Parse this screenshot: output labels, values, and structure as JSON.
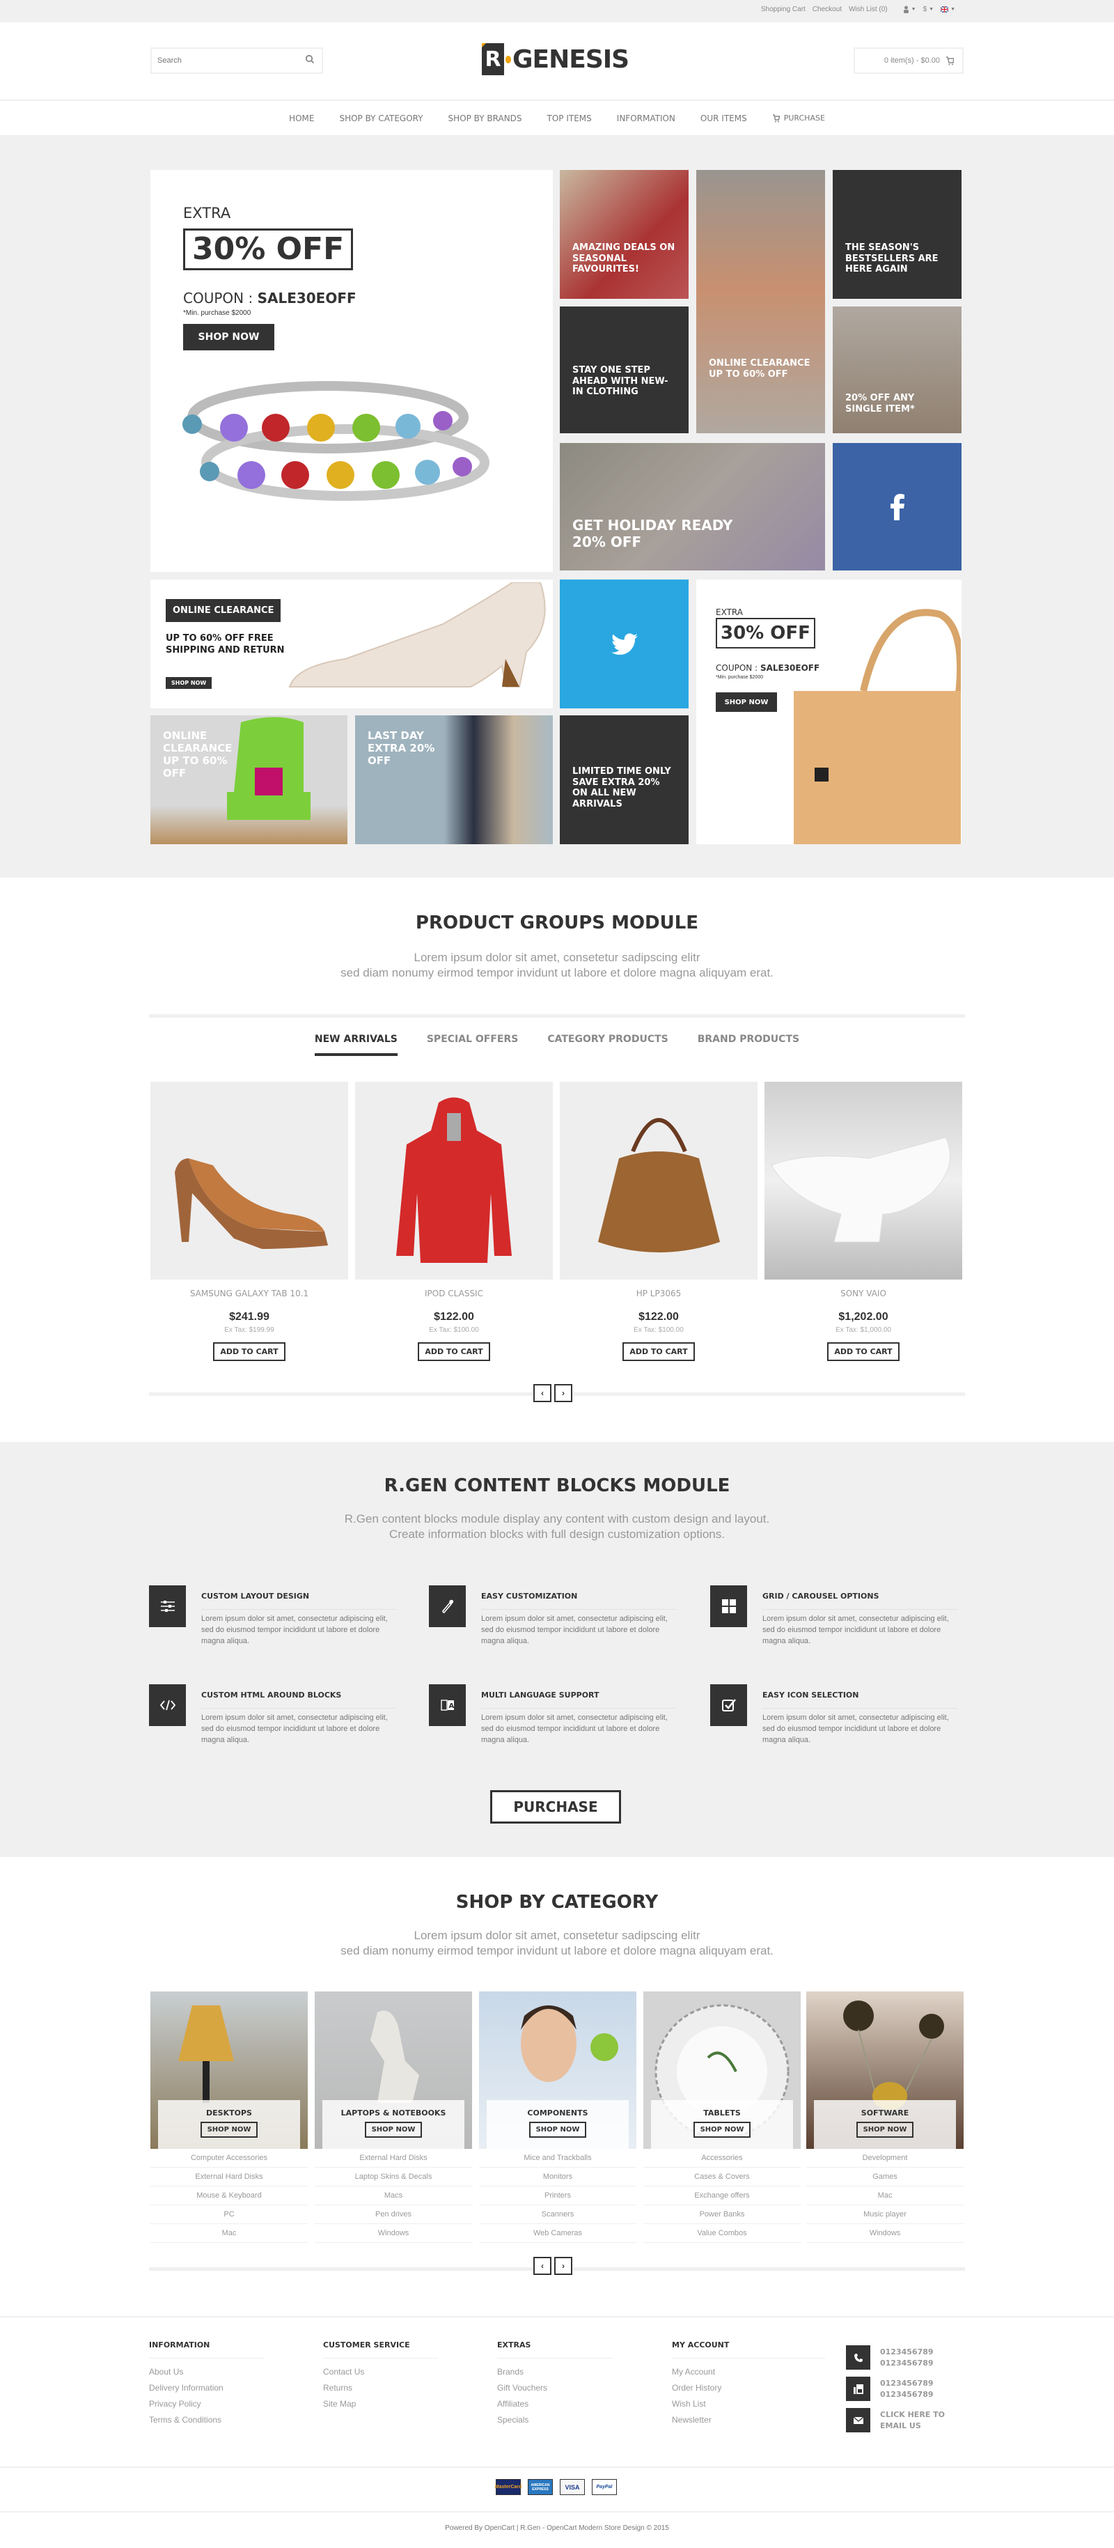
{
  "topbar": {
    "links": [
      "Shopping Cart",
      "Checkout",
      "Wish List (0)"
    ],
    "account_icon": "user-icon",
    "currency": "$",
    "language_icon": "flag-uk-icon"
  },
  "header": {
    "search_placeholder": "Search",
    "logo_letter": "R",
    "logo_text": "GENESIS",
    "cart_text": "0 item(s) - $0.00"
  },
  "nav": {
    "items": [
      "HOME",
      "SHOP BY CATEGORY",
      "SHOP BY BRANDS",
      "TOP ITEMS",
      "INFORMATION",
      "OUR ITEMS",
      "PURCHASE"
    ]
  },
  "banners": {
    "main": {
      "extra": "EXTRA",
      "offer": "30% OFF",
      "coupon_label": "COUPON : ",
      "coupon_code": "SALE30EOFF",
      "min": "*Min. purchase $2000",
      "button": "SHOP NOW"
    },
    "amazing": "AMAZING DEALS ON SEASONAL FAVOURITES!",
    "couple": "ONLINE CLEARANCE UP TO 60% OFF",
    "bestsellers": "THE SEASON'S BESTSELLERS ARE HERE AGAIN",
    "stay": "STAY ONE STEP AHEAD WITH NEW-IN CLOTHING",
    "sunglasses": "20% OFF ANY SINGLE ITEM*",
    "holiday": "GET HOLIDAY READY 20% OFF",
    "facebook_icon": "facebook-icon",
    "shoe": {
      "badge": "ONLINE CLEARANCE",
      "text": "UP TO 60% OFF FREE SHIPPING AND RETURN",
      "button": "SHOP NOW"
    },
    "twitter_icon": "twitter-icon",
    "bag": {
      "extra": "EXTRA",
      "offer": "30% OFF",
      "coupon_label": "COUPON : ",
      "coupon_code": "SALE30EOFF",
      "min": "*Min. purchase $2000",
      "button": "SHOP NOW"
    },
    "chair": "ONLINE CLEARANCE UP TO 60% OFF",
    "lastday": "LAST DAY EXTRA 20% OFF",
    "limited": "LIMITED TIME ONLY SAVE EXTRA 20% ON ALL NEW ARRIVALS"
  },
  "product_groups": {
    "title": "PRODUCT GROUPS MODULE",
    "subtitle_1": "Lorem ipsum dolor sit amet, consetetur sadipscing elitr",
    "subtitle_2": "sed diam nonumy eirmod tempor invidunt ut labore et dolore magna aliquyam erat.",
    "tabs": [
      "NEW ARRIVALS",
      "SPECIAL OFFERS",
      "CATEGORY PRODUCTS",
      "BRAND PRODUCTS"
    ],
    "active_tab": "NEW ARRIVALS",
    "products": [
      {
        "name": "SAMSUNG GALAXY TAB 10.1",
        "price": "$241.99",
        "ex_tax": "Ex Tax: $199.99",
        "button": "ADD TO CART",
        "image": "brown-heel-shoe"
      },
      {
        "name": "IPOD CLASSIC",
        "price": "$122.00",
        "ex_tax": "Ex Tax: $100.00",
        "button": "ADD TO CART",
        "image": "red-jacket"
      },
      {
        "name": "HP LP3065",
        "price": "$122.00",
        "ex_tax": "Ex Tax: $100.00",
        "button": "ADD TO CART",
        "image": "brown-handbag"
      },
      {
        "name": "SONY VAIO",
        "price": "$1,202.00",
        "ex_tax": "Ex Tax: $1,000.00",
        "button": "ADD TO CART",
        "image": "white-gravy-boat"
      }
    ],
    "prev": "‹",
    "next": "›"
  },
  "content_blocks": {
    "title": "R.GEN CONTENT BLOCKS MODULE",
    "subtitle_1": "R.Gen content blocks module display any content with custom design and layout.",
    "subtitle_2": "Create information blocks with full design customization options.",
    "features": [
      {
        "title": "CUSTOM LAYOUT DESIGN",
        "text": "Lorem ipsum dolor sit amet, consectetur adipiscing elit, sed do eiusmod tempor incididunt ut labore et dolore magna aliqua.",
        "icon": "sliders-icon"
      },
      {
        "title": "EASY CUSTOMIZATION",
        "text": "Lorem ipsum dolor sit amet, consectetur adipiscing elit, sed do eiusmod tempor incididunt ut labore et dolore magna aliqua.",
        "icon": "eyedropper-icon"
      },
      {
        "title": "GRID / CAROUSEL OPTIONS",
        "text": "Lorem ipsum dolor sit amet, consectetur adipiscing elit, sed do eiusmod tempor incididunt ut labore et dolore magna aliqua.",
        "icon": "grid-icon"
      },
      {
        "title": "CUSTOM HTML AROUND BLOCKS",
        "text": "Lorem ipsum dolor sit amet, consectetur adipiscing elit, sed do eiusmod tempor incididunt ut labore et dolore magna aliqua.",
        "icon": "code-icon"
      },
      {
        "title": "MULTI LANGUAGE SUPPORT",
        "text": "Lorem ipsum dolor sit amet, consectetur adipiscing elit, sed do eiusmod tempor incididunt ut labore et dolore magna aliqua.",
        "icon": "translate-icon"
      },
      {
        "title": "EASY ICON SELECTION",
        "text": "Lorem ipsum dolor sit amet, consectetur adipiscing elit, sed do eiusmod tempor incididunt ut labore et dolore magna aliqua.",
        "icon": "checkbox-icon"
      }
    ],
    "purchase_button": "PURCHASE"
  },
  "shop_by_category": {
    "title": "SHOP BY CATEGORY",
    "subtitle_1": "Lorem ipsum dolor sit amet, consetetur sadipscing elitr",
    "subtitle_2": "sed diam nonumy eirmod tempor invidunt ut labore et dolore magna aliquyam erat.",
    "categories": [
      {
        "name": "DESKTOPS",
        "button": "SHOP NOW",
        "links": [
          "Computer Accessories",
          "External Hard Disks",
          "Mouse & Keyboard",
          "PC",
          "Mac"
        ]
      },
      {
        "name": "LAPTOPS & NOTEBOOKS",
        "button": "SHOP NOW",
        "links": [
          "External Hard Disks",
          "Laptop Skins & Decals",
          "Macs",
          "Pen drives",
          "Windows"
        ]
      },
      {
        "name": "COMPONENTS",
        "button": "SHOP NOW",
        "links": [
          "Mice and Trackballs",
          "Monitors",
          "Printers",
          "Scanners",
          "Web Cameras"
        ]
      },
      {
        "name": "TABLETS",
        "button": "SHOP NOW",
        "links": [
          "Accessories",
          "Cases & Covers",
          "Exchange offers",
          "Power Banks",
          "Value Combos"
        ]
      },
      {
        "name": "SOFTWARE",
        "button": "SHOP NOW",
        "links": [
          "Development",
          "Games",
          "Mac",
          "Music player",
          "Windows"
        ]
      }
    ],
    "prev": "‹",
    "next": "›"
  },
  "footer": {
    "columns": [
      {
        "title": "INFORMATION",
        "links": [
          "About Us",
          "Delivery Information",
          "Privacy Policy",
          "Terms & Conditions"
        ]
      },
      {
        "title": "CUSTOMER SERVICE",
        "links": [
          "Contact Us",
          "Returns",
          "Site Map"
        ]
      },
      {
        "title": "EXTRAS",
        "links": [
          "Brands",
          "Gift Vouchers",
          "Affiliates",
          "Specials"
        ]
      },
      {
        "title": "MY ACCOUNT",
        "links": [
          "My Account",
          "Order History",
          "Wish List",
          "Newsletter"
        ]
      }
    ],
    "contacts": [
      {
        "icon": "phone-icon",
        "line1": "0123456789",
        "line2": "0123456789"
      },
      {
        "icon": "fax-icon",
        "line1": "0123456789",
        "line2": "0123456789"
      },
      {
        "icon": "envelope-icon",
        "line1": "CLICK HERE TO",
        "line2": "EMAIL US"
      }
    ],
    "payments": [
      "MasterCard",
      "AMERICAN EXPRESS",
      "VISA",
      "PayPal"
    ],
    "copyright": "Powered By OpenCart  |  R.Gen - OpenCart Modern Store Design © 2015"
  },
  "colors": {
    "dark": "#333333",
    "light_bg": "#f0f0f0",
    "accent_yellow": "#f0a30a",
    "facebook": "#3b63a6",
    "twitter": "#2aa7e1"
  }
}
